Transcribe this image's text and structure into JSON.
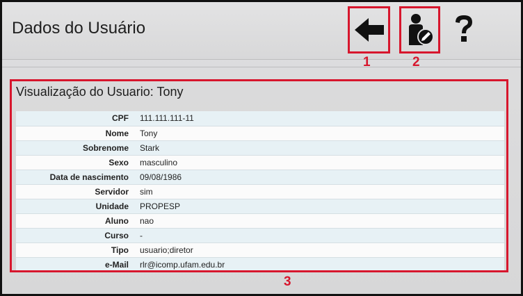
{
  "header": {
    "title": "Dados do Usuário"
  },
  "toolbar": {
    "back": {
      "icon": "arrow-left-icon"
    },
    "edit": {
      "icon": "user-edit-icon"
    },
    "help": {
      "icon": "question-mark-icon"
    }
  },
  "annotations": {
    "callout_1": "1",
    "callout_2": "2",
    "callout_3": "3",
    "color": "#d7162d"
  },
  "panel": {
    "title": "Visualização do Usuario: Tony",
    "rows": [
      {
        "label": "CPF",
        "value": "111.111.111-11"
      },
      {
        "label": "Nome",
        "value": "Tony"
      },
      {
        "label": "Sobrenome",
        "value": "Stark"
      },
      {
        "label": "Sexo",
        "value": "masculino"
      },
      {
        "label": "Data de nascimento",
        "value": "09/08/1986"
      },
      {
        "label": "Servidor",
        "value": "sim"
      },
      {
        "label": "Unidade",
        "value": "PROPESP"
      },
      {
        "label": "Aluno",
        "value": "nao"
      },
      {
        "label": "Curso",
        "value": "-"
      },
      {
        "label": "Tipo",
        "value": "usuario;diretor"
      },
      {
        "label": "e-Mail",
        "value": "rlr@icomp.ufam.edu.br"
      }
    ]
  },
  "colors": {
    "row_alt": "#e7f1f5",
    "row_plain": "#fbfbfb",
    "icon": "#111111"
  }
}
